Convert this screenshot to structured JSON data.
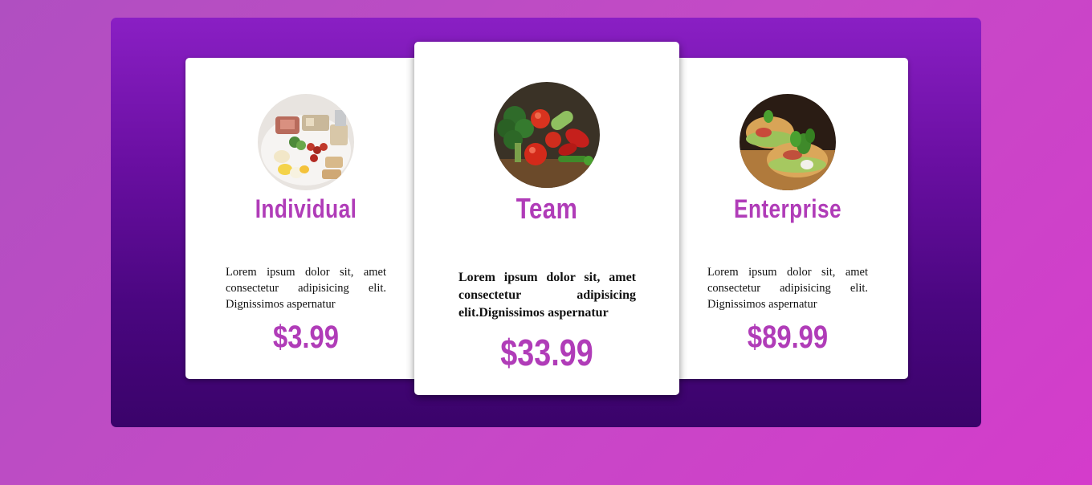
{
  "plans": [
    {
      "title": "Individual",
      "description": "Lorem ipsum dolor sit, amet consectetur adipisicing elit. Dignissimos aspernatur",
      "price": "$3.99",
      "image": "platter-image"
    },
    {
      "title": "Team",
      "description": "Lorem ipsum dolor sit, amet consectetur adipisicing elit.Dignissimos aspernatur",
      "price": "$33.99",
      "image": "vegetables-image"
    },
    {
      "title": "Enterprise",
      "description": "Lorem ipsum dolor sit, amet consectetur adipisicing elit. Dignissimos aspernatur",
      "price": "$89.99",
      "image": "sandwich-image"
    }
  ],
  "colors": {
    "accent": "#b03cb8",
    "panel_top": "#8a1fc4",
    "panel_bottom": "#3a036a",
    "background": "#c44ac6"
  }
}
